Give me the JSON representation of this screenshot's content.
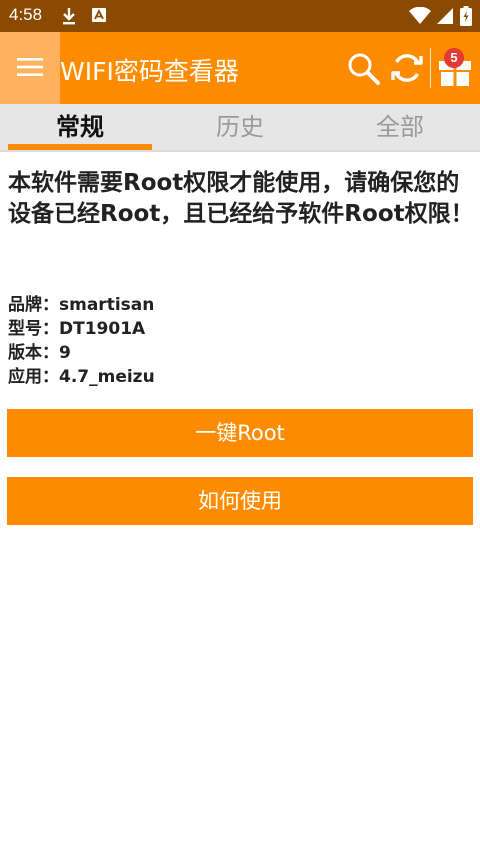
{
  "status_bar": {
    "time": "4:58",
    "icons": [
      "download-icon",
      "app-notification-icon",
      "wifi-icon",
      "signal-icon",
      "battery-icon"
    ]
  },
  "app_bar": {
    "title": "WIFI密码查看器",
    "badge_count": "5",
    "accent": "#ff8c00",
    "icons": [
      "menu-icon",
      "search-icon",
      "refresh-icon",
      "gift-icon"
    ]
  },
  "tabs": [
    {
      "label": "常规",
      "active": true
    },
    {
      "label": "历史",
      "active": false
    },
    {
      "label": "全部",
      "active": false
    }
  ],
  "main": {
    "notice": "本软件需要Root权限才能使用，请确保您的设备已经Root，且已经给予软件Root权限！",
    "info": [
      {
        "label": "品牌：",
        "value": "smartisan"
      },
      {
        "label": "型号：",
        "value": "DT1901A"
      },
      {
        "label": "版本：",
        "value": "9"
      },
      {
        "label": "应用：",
        "value": "4.7_meizu"
      }
    ],
    "root_button": "一键Root",
    "help_button": "如何使用"
  }
}
